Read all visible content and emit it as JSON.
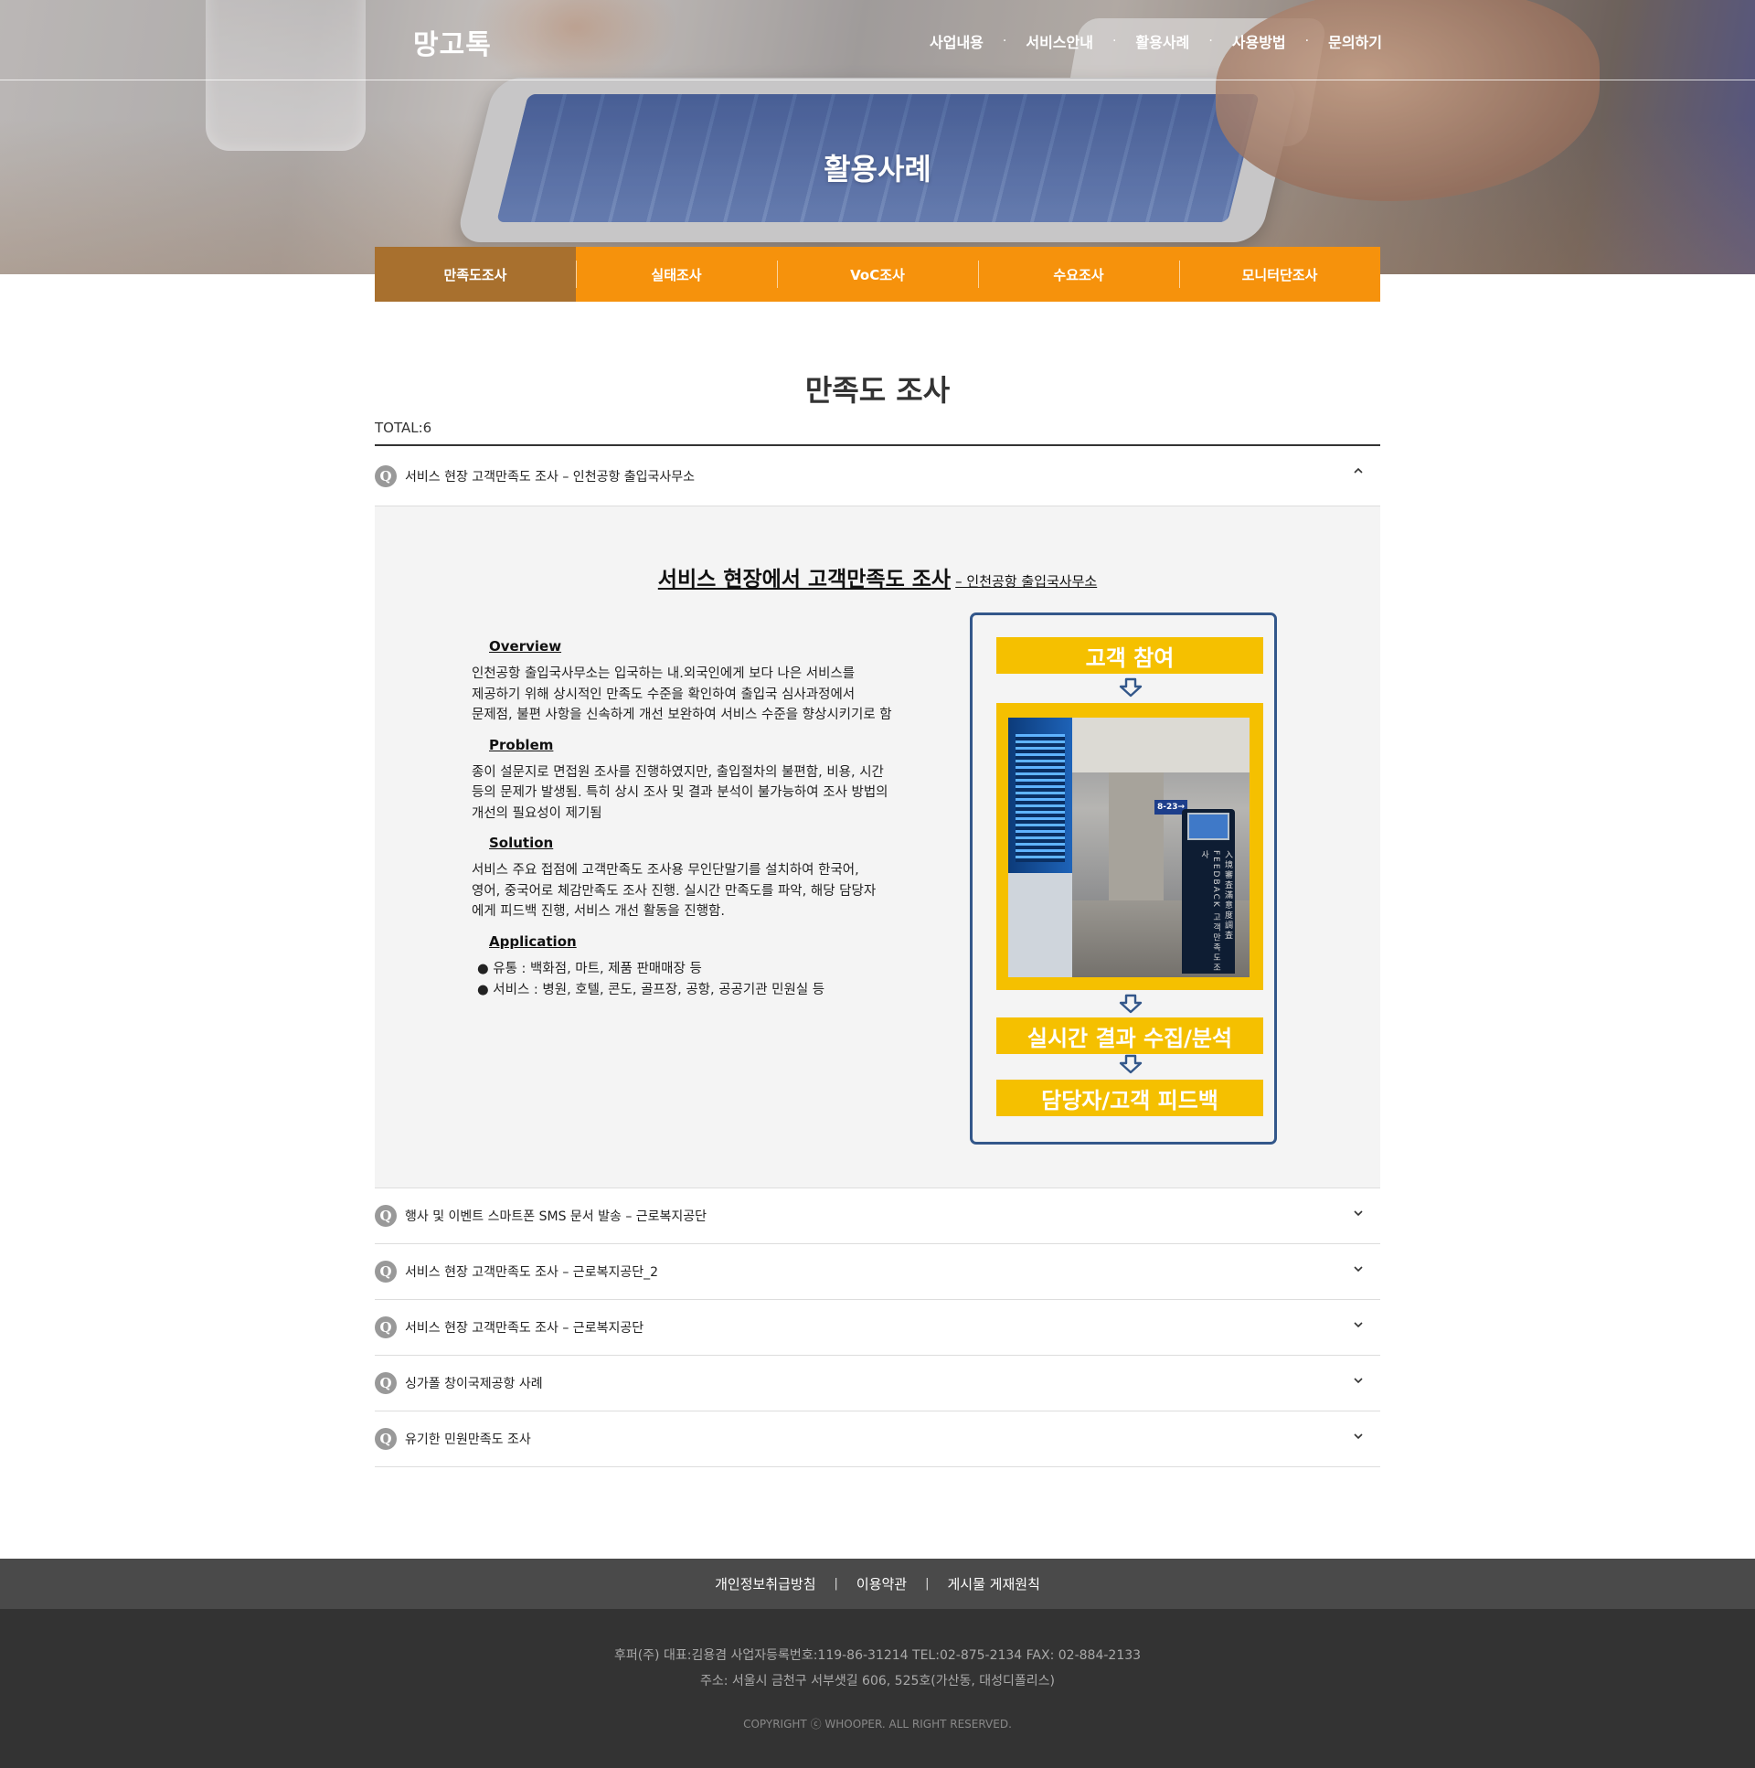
{
  "header": {
    "logo": "망고톡",
    "nav": [
      "사업내용",
      "서비스안내",
      "활용사례",
      "사용방법",
      "문의하기"
    ],
    "hero_title": "활용사례"
  },
  "tabs": [
    "만족도조사",
    "실태조사",
    "VoC조사",
    "수요조사",
    "모니터단조사"
  ],
  "active_tab": "만족도조사",
  "section_title": "만족도 조사",
  "total": "TOTAL:6",
  "list": {
    "q_icon": "Q",
    "items": [
      "서비스 현장 고객만족도 조사 – 인천공항 출입국사무소",
      "행사 및 이벤트 스마트폰 SMS 문서 발송 – 근로복지공단",
      "서비스 현장 고객만족도 조사 – 근로복지공단_2",
      "서비스 현장 고객만족도 조사 – 근로복지공단",
      "싱가폴 창이국제공항 사례",
      "유기한 민원만족도 조사"
    ]
  },
  "detail": {
    "title_big": "서비스 현장에서 고객만족도 조사",
    "title_small": "– 인천공항 출입국사무소",
    "overview_h": "Overview",
    "overview": " 인천공항 출입국사무소는 입국하는 내.외국인에게 보다 나은 서비스를\n제공하기 위해 상시적인 만족도 수준을 확인하여 출입국 심사과정에서\n문제점, 불편 사항을 신속하게 개선 보완하여 서비스 수준을 향상시키기로 함",
    "problem_h": "Problem",
    "problem": " 종이 설문지로 면접원 조사를 진행하였지만, 출입절차의 불편함, 비용, 시간\n등의 문제가 발생됨. 특히 상시 조사 및 결과 분석이 불가능하여 조사 방법의\n개선의 필요성이 제기됨",
    "solution_h": "Solution",
    "solution": " 서비스 주요 접점에 고객만족도 조사용 무인단말기를 설치하여 한국어,\n영어, 중국어로 체감만족도 조사 진행. 실시간 만족도를 파악, 해당 담당자\n에게 피드백 진행, 서비스 개선 활동을 진행함.",
    "application_h": "Application",
    "app_items": [
      "● 유통 : 백화점, 마트, 제품 판매매장 등",
      "● 서비스 : 병원, 호텔, 콘도, 골프장, 공항, 공공기관 민원실 등"
    ],
    "diagram": {
      "step1": "고객 참여",
      "step2": "실시간 결과 수집/분석",
      "step3": "담당자/고객 피드백",
      "photo_sign": "8-23→",
      "kiosk_text": "入境審査滿意度調査 FEEDBACK 고객만족도조사"
    }
  },
  "footer": {
    "links": [
      "개인정보취급방침",
      "이용약관",
      "게시물 게재원칙"
    ],
    "separator": "|",
    "info_line1": "후퍼(주)   대표:김용겸   사업자등록번호:119-86-31214   TEL:02-875-2134   FAX: 02-884-2133",
    "info_line2": "주소: 서울시 금천구 서부샛길 606, 525호(가산동, 대성디폴리스)",
    "copyright": "COPYRIGHT ⓒ WHOOPER. ALL RIGHT RESERVED."
  },
  "colors": {
    "tab_bg": "#f6920c",
    "tab_active": "#a8702e",
    "diagram_yellow": "#f5c000",
    "diagram_border": "#33578a",
    "footer_top": "#4a4a4a",
    "footer_bottom": "#333333"
  },
  "icons": {
    "row_open": "chevron-up-icon",
    "row_closed": "chevron-down-icon",
    "diagram_arrow": "arrow-down-icon"
  }
}
